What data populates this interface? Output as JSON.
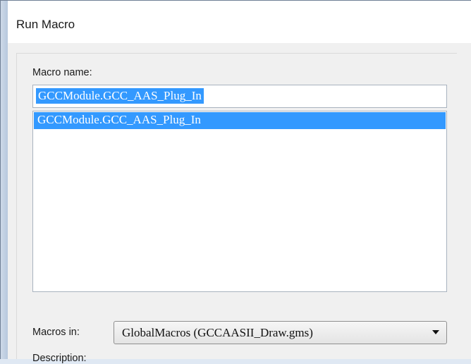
{
  "window": {
    "title": "Run Macro"
  },
  "macro_name": {
    "label": "Macro name:",
    "value": "GCCModule.GCC_AAS_Plug_In",
    "list": [
      "GCCModule.GCC_AAS_Plug_In"
    ]
  },
  "macros_in": {
    "label": "Macros in:",
    "selected": "GlobalMacros (GCCAASII_Draw.gms)"
  },
  "description": {
    "label": "Description:"
  },
  "colors": {
    "selection": "#3399ff",
    "window": "#f0f0f0"
  }
}
